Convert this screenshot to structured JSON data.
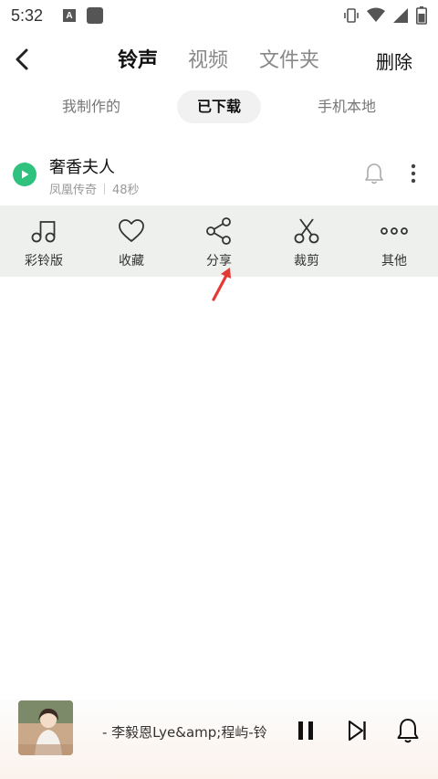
{
  "status_bar": {
    "time": "5:32",
    "a_badge": "A",
    "icons": [
      "vibrate-icon",
      "wifi-icon",
      "signal-icon",
      "battery-icon"
    ]
  },
  "header": {
    "tabs": [
      {
        "label": "铃声",
        "active": true
      },
      {
        "label": "视频",
        "active": false
      },
      {
        "label": "文件夹",
        "active": false
      }
    ],
    "delete_label": "删除"
  },
  "subtabs": [
    {
      "label": "我制作的",
      "active": false
    },
    {
      "label": "已下载",
      "active": true
    },
    {
      "label": "手机本地",
      "active": false
    }
  ],
  "song": {
    "title": "奢香夫人",
    "artist": "凤凰传奇",
    "duration": "48秒"
  },
  "actions": [
    {
      "label": "彩铃版",
      "icon": "music-note-icon"
    },
    {
      "label": "收藏",
      "icon": "heart-icon"
    },
    {
      "label": "分享",
      "icon": "share-icon"
    },
    {
      "label": "裁剪",
      "icon": "scissors-icon"
    },
    {
      "label": "其他",
      "icon": "more-horizontal-icon"
    }
  ],
  "player": {
    "now_playing": "- 李毅恩Lye&amp;程屿-铃",
    "icons": [
      "album-art",
      "pause-icon",
      "next-track-icon",
      "bell-icon"
    ]
  },
  "colors": {
    "accent_green": "#2ec27e",
    "action_bar_bg": "#eef0ee",
    "arrow_red": "#e53935"
  }
}
